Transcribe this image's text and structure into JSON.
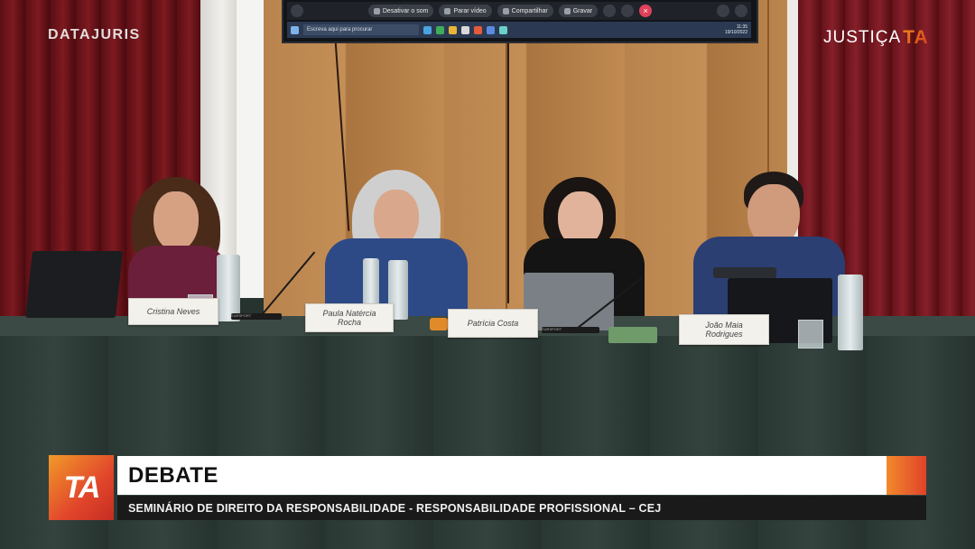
{
  "branding": {
    "left_logo": "DATAJURIS",
    "right_logo_text": "JUSTIÇA",
    "right_logo_mark": "TA",
    "lower_third_mark": "TA",
    "accent_orange": "#f0902a",
    "accent_red": "#e0422a"
  },
  "screen": {
    "toolbar": [
      "Desativar o som",
      "Parar vídeo",
      "Compartilhar",
      "Gravar"
    ],
    "taskbar_search": "Escreva aqui para procurar",
    "clock_time": "11:35",
    "clock_date": "19/10/2022"
  },
  "panel": {
    "nameplates": [
      {
        "name": "Cristina Neves"
      },
      {
        "name": "Paula Natércia Rocha"
      },
      {
        "name": "Patrícia Costa"
      },
      {
        "name": "João Maia Rodrigues"
      }
    ],
    "mic_brand": "EURSPORT"
  },
  "lower_third": {
    "title": "DEBATE",
    "subtitle": "SEMINÁRIO DE DIREITO DA RESPONSABILIDADE - RESPONSABILIDADE PROFISSIONAL – CEJ"
  }
}
